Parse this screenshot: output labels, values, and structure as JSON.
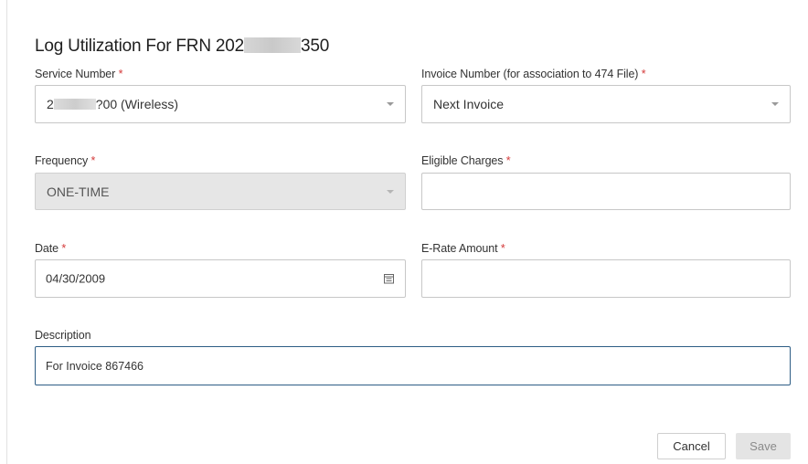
{
  "dialog": {
    "title_prefix": "Log Utilization For FRN 202",
    "title_suffix": "350"
  },
  "form": {
    "required_marker": "*",
    "service_number": {
      "label": "Service Number",
      "value_prefix": "2",
      "value_suffix": "?00 (Wireless)"
    },
    "invoice_number": {
      "label": "Invoice Number (for association to 474 File)",
      "value": "Next Invoice"
    },
    "frequency": {
      "label": "Frequency",
      "value": "ONE-TIME"
    },
    "eligible_charges": {
      "label": "Eligible Charges",
      "value": ""
    },
    "date": {
      "label": "Date",
      "value": "04/30/2009"
    },
    "erate_amount": {
      "label": "E-Rate Amount",
      "value": ""
    },
    "description": {
      "label": "Description",
      "value": "For Invoice 867466"
    }
  },
  "buttons": {
    "cancel": "Cancel",
    "save": "Save"
  },
  "icons": {
    "dropdown": "chevron-down-icon",
    "calendar": "calendar-icon"
  }
}
